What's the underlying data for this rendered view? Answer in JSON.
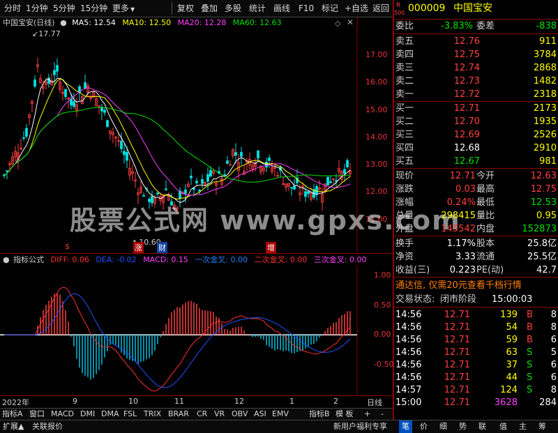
{
  "toolbar": {
    "items": [
      "分时",
      "1分钟",
      "5分钟",
      "15分钟",
      "更多",
      "复权",
      "叠加",
      "多股",
      "统计",
      "画线",
      "F10",
      "标记",
      "+自选",
      "返回"
    ],
    "more_arrow": "▼"
  },
  "main_chart": {
    "title": "中国宝安(日线)",
    "ma5": "MA5: 12.54",
    "ma10": "MA10: 12.50",
    "ma20": "MA20: 12.28",
    "ma60": "MA60: 12.63",
    "high_label": "17.77",
    "low_label": "10.60",
    "price_ticks": [
      "17.00",
      "16.00",
      "15.00",
      "14.00",
      "13.00",
      "12.00",
      "11.00"
    ],
    "markers": [
      {
        "text": "$",
        "color": "#ff3030"
      },
      {
        "text": "涨",
        "color": "#ffffff"
      },
      {
        "text": "财",
        "color": "#ffffff"
      },
      {
        "text": "增",
        "color": "#ffffff"
      }
    ]
  },
  "indicator": {
    "name": "指标公式",
    "diff": "DIFF: 0.06",
    "dea": "DEA: -0.02",
    "macd": "MACD: 0.15",
    "first_cross": "一次金叉: 0.00",
    "second_cross": "二次金叉: 0.00",
    "third_cross": "三次金叉: 0.00",
    "ticks": [
      "1.00",
      "0.50",
      "0.00",
      "-0.50"
    ]
  },
  "date_axis": {
    "year": "2022年",
    "months": [
      "9",
      "10",
      "11",
      "12",
      "1",
      "2"
    ],
    "period": "日线"
  },
  "bottom_tabs": [
    "指标A",
    "窗口",
    "MACD",
    "DMI",
    "DMA",
    "FSL",
    "TRIX",
    "BRAR",
    "CR",
    "VR",
    "OBV",
    "ASI",
    "EMV",
    "指标B",
    "模 板",
    "+",
    "-"
  ],
  "bottom_bar": {
    "left": [
      "扩展▲",
      "关联报价"
    ],
    "promo": "新用户福利专享",
    "tabs": [
      "笔",
      "价",
      "细",
      "势",
      "联",
      "值",
      "主",
      "筹"
    ]
  },
  "watermark": "股票公式网 www.gpxs.com",
  "quote": {
    "code_prefix": "R",
    "code_sub": "500",
    "code": "000009",
    "name": "中国宝安",
    "weibi_label": "委比",
    "weibi": "-3.83%",
    "weicha_label": "委差",
    "weicha": "-838",
    "asks": [
      {
        "label": "卖五",
        "price": "12.76",
        "vol": "911"
      },
      {
        "label": "卖四",
        "price": "12.75",
        "vol": "3784"
      },
      {
        "label": "卖三",
        "price": "12.74",
        "vol": "2868"
      },
      {
        "label": "卖二",
        "price": "12.73",
        "vol": "1482"
      },
      {
        "label": "卖一",
        "price": "12.72",
        "vol": "2318"
      }
    ],
    "bids": [
      {
        "label": "买一",
        "price": "12.71",
        "vol": "2173"
      },
      {
        "label": "买二",
        "price": "12.70",
        "vol": "1935"
      },
      {
        "label": "买三",
        "price": "12.69",
        "vol": "2526"
      },
      {
        "label": "买四",
        "price": "12.68",
        "vol": "2910"
      },
      {
        "label": "买五",
        "price": "12.67",
        "vol": "981"
      }
    ],
    "stats": [
      {
        "l1": "现价",
        "v1": "12.71",
        "l2": "今开",
        "v2": "12.63"
      },
      {
        "l1": "涨跌",
        "v1": "0.03",
        "l2": "最高",
        "v2": "12.75"
      },
      {
        "l1": "涨幅",
        "v1": "0.24%",
        "l2": "最低",
        "v2": "12.53"
      },
      {
        "l1": "总量",
        "v1": "298415",
        "l2": "量比",
        "v2": "0.95"
      },
      {
        "l1": "外盘",
        "v1": "145542",
        "l2": "内盘",
        "v2": "152873"
      }
    ],
    "fund": [
      {
        "l1": "换手",
        "v1": "1.17%",
        "l2": "股本",
        "v2": "25.8亿"
      },
      {
        "l1": "净资",
        "v1": "3.33",
        "l2": "流通",
        "v2": "25.5亿"
      },
      {
        "l1": "收益(三)",
        "v1": "0.223",
        "l2": "PE(动)",
        "v2": "42.7"
      }
    ],
    "promo": "通达信, 仅需20元查看千档行情",
    "status_label": "交易状态:",
    "status": "闭市阶段",
    "status_time": "15:00:03",
    "ticks": [
      {
        "time": "14:56",
        "price": "12.71",
        "vol": "139",
        "bs": "B",
        "n": "8"
      },
      {
        "time": "14:56",
        "price": "12.71",
        "vol": "54",
        "bs": "B",
        "n": "8"
      },
      {
        "time": "14:56",
        "price": "12.71",
        "vol": "59",
        "bs": "B",
        "n": "6"
      },
      {
        "time": "14:56",
        "price": "12.71",
        "vol": "63",
        "bs": "S",
        "n": "5"
      },
      {
        "time": "14:56",
        "price": "12.71",
        "vol": "37",
        "bs": "S",
        "n": "6"
      },
      {
        "time": "14:56",
        "price": "12.71",
        "vol": "44",
        "bs": "S",
        "n": "6"
      },
      {
        "time": "14:57",
        "price": "12.71",
        "vol": "124",
        "bs": "S",
        "n": "8"
      },
      {
        "time": "15:00",
        "price": "12.71",
        "vol": "3628",
        "bs": "",
        "n": "284"
      }
    ]
  },
  "colors": {
    "up": "#ff4040",
    "down": "#00e000",
    "ma5": "#ffffff",
    "ma10": "#ffff00",
    "ma20": "#ff40ff",
    "ma60": "#00e000",
    "diff": "#ff3030",
    "dea": "#2050ff"
  }
}
